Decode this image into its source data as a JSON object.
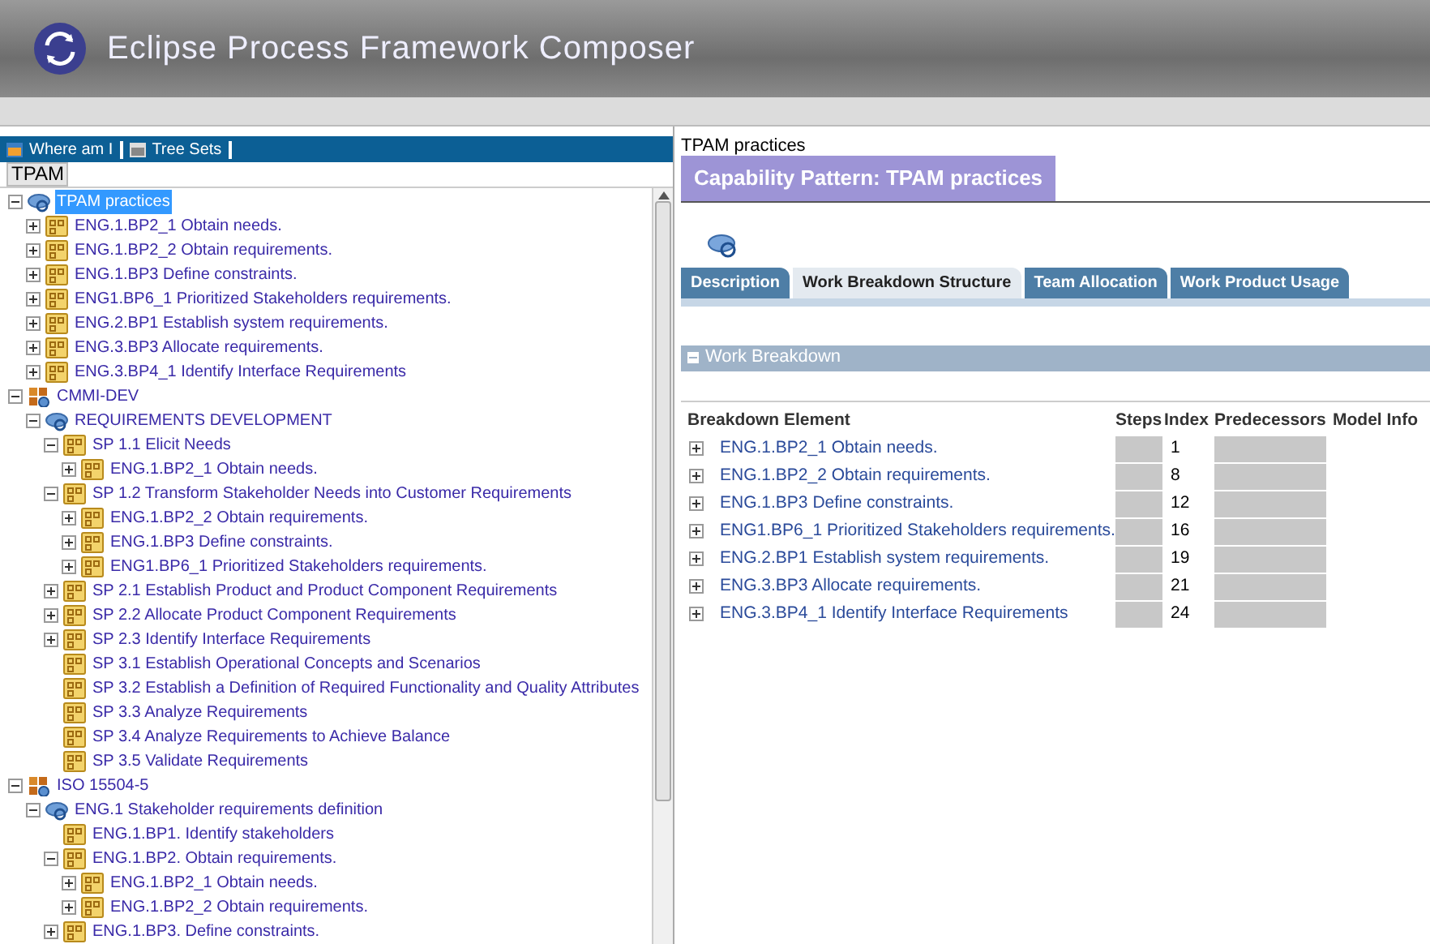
{
  "app": {
    "title": "Eclipse Process Framework Composer"
  },
  "toolbar": [
    "Where am I",
    "Tree Sets"
  ],
  "tree_tab": {
    "label": "TPAM"
  },
  "tree": [
    {
      "kind": "process",
      "label": "TPAM practices",
      "expanded": true,
      "selected": true,
      "children": [
        {
          "kind": "pattern",
          "label": "ENG.1.BP2_1 Obtain needs.",
          "expanded": false,
          "selected": false
        },
        {
          "kind": "pattern",
          "label": "ENG.1.BP2_2 Obtain requirements.",
          "expanded": false,
          "selected": false
        },
        {
          "kind": "pattern",
          "label": "ENG.1.BP3 Define constraints.",
          "expanded": false,
          "selected": false
        },
        {
          "kind": "pattern",
          "label": "ENG1.BP6_1 Prioritized Stakeholders requirements.",
          "expanded": false,
          "selected": false
        },
        {
          "kind": "pattern",
          "label": "ENG.2.BP1 Establish system requirements.",
          "expanded": false,
          "selected": false
        },
        {
          "kind": "pattern",
          "label": "ENG.3.BP3 Allocate requirements.",
          "expanded": false,
          "selected": false
        },
        {
          "kind": "pattern",
          "label": "ENG.3.BP4_1 Identify Interface Requirements",
          "expanded": false,
          "selected": false
        }
      ]
    },
    {
      "kind": "plugin",
      "label": "CMMI-DEV",
      "expanded": true,
      "selected": false,
      "children": [
        {
          "kind": "process",
          "label": "REQUIREMENTS DEVELOPMENT",
          "expanded": true,
          "selected": false,
          "children": [
            {
              "kind": "pattern",
              "label": "SP 1.1 Elicit Needs",
              "expanded": true,
              "selected": false,
              "children": [
                {
                  "kind": "pattern",
                  "label": "ENG.1.BP2_1 Obtain needs.",
                  "expanded": false,
                  "selected": false
                }
              ]
            },
            {
              "kind": "pattern",
              "label": "SP 1.2 Transform Stakeholder Needs into Customer Requirements",
              "expanded": true,
              "selected": false,
              "children": [
                {
                  "kind": "pattern",
                  "label": "ENG.1.BP2_2 Obtain requirements.",
                  "expanded": false,
                  "selected": false
                },
                {
                  "kind": "pattern",
                  "label": "ENG.1.BP3 Define constraints.",
                  "expanded": false,
                  "selected": false
                },
                {
                  "kind": "pattern",
                  "label": "ENG1.BP6_1 Prioritized Stakeholders requirements.",
                  "expanded": false,
                  "selected": false
                }
              ]
            },
            {
              "kind": "pattern",
              "label": "SP 2.1 Establish Product and Product Component Requirements",
              "expanded": false,
              "selected": false
            },
            {
              "kind": "pattern",
              "label": "SP 2.2 Allocate Product Component Requirements",
              "expanded": false,
              "selected": false
            },
            {
              "kind": "pattern",
              "label": "SP 2.3 Identify Interface Requirements",
              "expanded": false,
              "selected": false
            },
            {
              "kind": "pattern",
              "label": "SP 3.1 Establish Operational Concepts and Scenarios",
              "selected": false
            },
            {
              "kind": "pattern",
              "label": "SP 3.2 Establish a Definition of Required Functionality and Quality Attributes",
              "selected": false
            },
            {
              "kind": "pattern",
              "label": "SP 3.3 Analyze Requirements",
              "selected": false
            },
            {
              "kind": "pattern",
              "label": "SP 3.4 Analyze Requirements to Achieve Balance",
              "selected": false
            },
            {
              "kind": "pattern",
              "label": "SP 3.5 Validate Requirements",
              "selected": false
            }
          ]
        }
      ]
    },
    {
      "kind": "plugin",
      "label": "ISO 15504-5",
      "expanded": true,
      "selected": false,
      "children": [
        {
          "kind": "process",
          "label": "ENG.1 Stakeholder requirements definition",
          "expanded": true,
          "selected": false,
          "children": [
            {
              "kind": "pattern",
              "label": "ENG.1.BP1. Identify stakeholders",
              "selected": false
            },
            {
              "kind": "pattern",
              "label": "ENG.1.BP2. Obtain requirements.",
              "expanded": true,
              "selected": false,
              "children": [
                {
                  "kind": "pattern",
                  "label": "ENG.1.BP2_1 Obtain needs.",
                  "expanded": false,
                  "selected": false
                },
                {
                  "kind": "pattern",
                  "label": "ENG.1.BP2_2 Obtain requirements.",
                  "expanded": false,
                  "selected": false
                }
              ]
            },
            {
              "kind": "pattern",
              "label": "ENG.1.BP3. Define constraints.",
              "expanded": false,
              "selected": false
            }
          ]
        }
      ]
    }
  ],
  "content": {
    "breadcrumb": "TPAM practices",
    "title": "Capability Pattern: TPAM practices",
    "tabs": [
      {
        "label": "Description",
        "selected": false
      },
      {
        "label": "Work Breakdown Structure",
        "selected": true
      },
      {
        "label": "Team Allocation",
        "selected": false
      },
      {
        "label": "Work Product Usage",
        "selected": false
      }
    ],
    "section": {
      "title": "Work Breakdown",
      "expanded": true
    },
    "table": {
      "columns": [
        "Breakdown Element",
        "Steps",
        "Index",
        "Predecessors",
        "Model Info"
      ],
      "rows": [
        {
          "element": "ENG.1.BP2_1 Obtain needs.",
          "index": "1",
          "expanded": false
        },
        {
          "element": "ENG.1.BP2_2 Obtain requirements.",
          "index": "8",
          "expanded": false
        },
        {
          "element": "ENG.1.BP3 Define constraints.",
          "index": "12",
          "expanded": false
        },
        {
          "element": "ENG1.BP6_1 Prioritized Stakeholders requirements.",
          "index": "16",
          "expanded": false
        },
        {
          "element": "ENG.2.BP1 Establish system requirements.",
          "index": "19",
          "expanded": false
        },
        {
          "element": "ENG.3.BP3 Allocate requirements.",
          "index": "21",
          "expanded": false
        },
        {
          "element": "ENG.3.BP4_1 Identify Interface Requirements",
          "index": "24",
          "expanded": false
        }
      ]
    }
  }
}
